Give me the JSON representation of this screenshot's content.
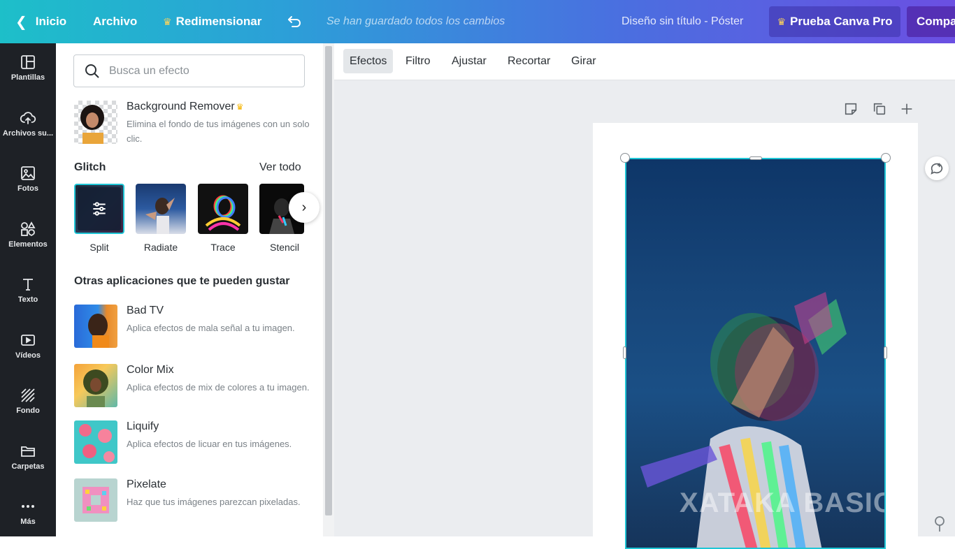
{
  "topbar": {
    "home": "Inicio",
    "file": "Archivo",
    "resize": "Redimensionar",
    "saved_status": "Se han guardado todos los cambios",
    "doc_title": "Diseño sin título - Póster",
    "pro_button": "Prueba Canva Pro",
    "share_button": "Compartir"
  },
  "leftnav": {
    "items": [
      {
        "label": "Plantillas",
        "icon": "templates-icon"
      },
      {
        "label": "Archivos su...",
        "icon": "upload-icon"
      },
      {
        "label": "Fotos",
        "icon": "photos-icon"
      },
      {
        "label": "Elementos",
        "icon": "elements-icon"
      },
      {
        "label": "Texto",
        "icon": "text-icon"
      },
      {
        "label": "Vídeos",
        "icon": "video-icon"
      },
      {
        "label": "Fondo",
        "icon": "background-icon"
      },
      {
        "label": "Carpetas",
        "icon": "folder-icon"
      },
      {
        "label": "Más",
        "icon": "more-icon"
      }
    ]
  },
  "panel": {
    "search_placeholder": "Busca un efecto",
    "featured": {
      "name": "Background Remover",
      "desc": "Elimina el fondo de tus imágenes con un solo clic."
    },
    "glitch": {
      "title": "Glitch",
      "see_all": "Ver todo",
      "items": [
        "Split",
        "Radiate",
        "Trace",
        "Stencil"
      ]
    },
    "other_title": "Otras aplicaciones que te pueden gustar",
    "apps": [
      {
        "name": "Bad TV",
        "desc": "Aplica efectos de mala señal a tu imagen."
      },
      {
        "name": "Color Mix",
        "desc": "Aplica efectos de mix de colores a tu imagen."
      },
      {
        "name": "Liquify",
        "desc": "Aplica efectos de licuar en tus imágenes."
      },
      {
        "name": "Pixelate",
        "desc": "Haz que tus imágenes parezcan pixeladas."
      }
    ]
  },
  "toolbar": {
    "tabs": [
      "Efectos",
      "Filtro",
      "Ajustar",
      "Recortar",
      "Girar"
    ],
    "active": "Efectos"
  },
  "canvas": {
    "watermark": "XATAKA BASICS"
  },
  "colors": {
    "accent": "#1fc6d6",
    "nav_bg": "#1e2126",
    "pro_crown": "#ffd45a"
  }
}
